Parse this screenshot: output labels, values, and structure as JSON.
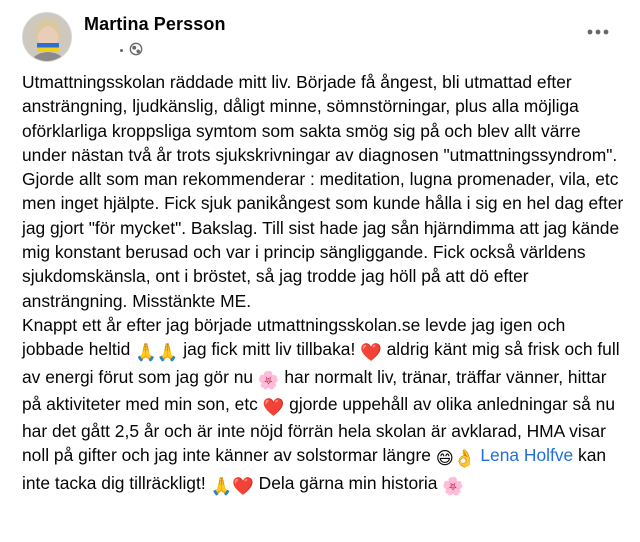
{
  "post": {
    "author": "Martina Persson",
    "author_avatar": "avatar",
    "audience_icon": "globe-icon",
    "more_icon": "more-options-icon",
    "paragraph_1": "Utmattningsskolan räddade mitt liv. Började få ångest, bli utmattad efter ansträngning, ljudkänslig, dåligt minne, sömnstörningar, plus alla möjliga oförklarliga kroppsliga symtom som sakta smög sig på och blev allt värre under nästan två år trots sjukskrivningar av diagnosen \"utmattningssyndrom\". Gjorde allt som man rekommenderar : meditation, lugna promenader, vila, etc men inget hjälpte. Fick sjuk panikångest som kunde hålla i sig en hel dag efter jag gjort \"för mycket\". Bakslag. Till sist hade jag sån hjärndimma att jag kände mig konstant berusad och var i princip sängliggande. Fick också världens sjukdomskänsla, ont i bröstet, så jag trodde jag höll på att dö efter ansträngning. Misstänkte ME.",
    "p2_a": "Knappt ett år efter jag började utmattningsskolan.se levde jag igen och jobbade heltid ",
    "p2_b": " jag fick mitt liv tillbaka! ",
    "p2_c": " aldrig känt mig så frisk och full av energi förut som jag gör nu ",
    "p2_d": " har normalt liv, tränar, träffar vänner, hittar på aktiviteter med min son, etc ",
    "p2_e": " gjorde uppehåll av olika anledningar så nu har det gått 2,5 år och är inte nöjd förrän hela skolan är avklarad, HMA visar noll på gifter och jag inte känner av solstormar längre ",
    "mention": "Lena Holfve",
    "p2_f": " kan inte tacka dig tillräckligt! ",
    "p2_g": " Dela gärna min historia ",
    "emoji": {
      "pray": "🙏",
      "heart": "❤️",
      "blossom": "🌸",
      "laugh": "😄",
      "ok_hand": "👌"
    },
    "colors": {
      "link": "#216fdb",
      "text": "#050505",
      "meta": "#65676b"
    }
  }
}
